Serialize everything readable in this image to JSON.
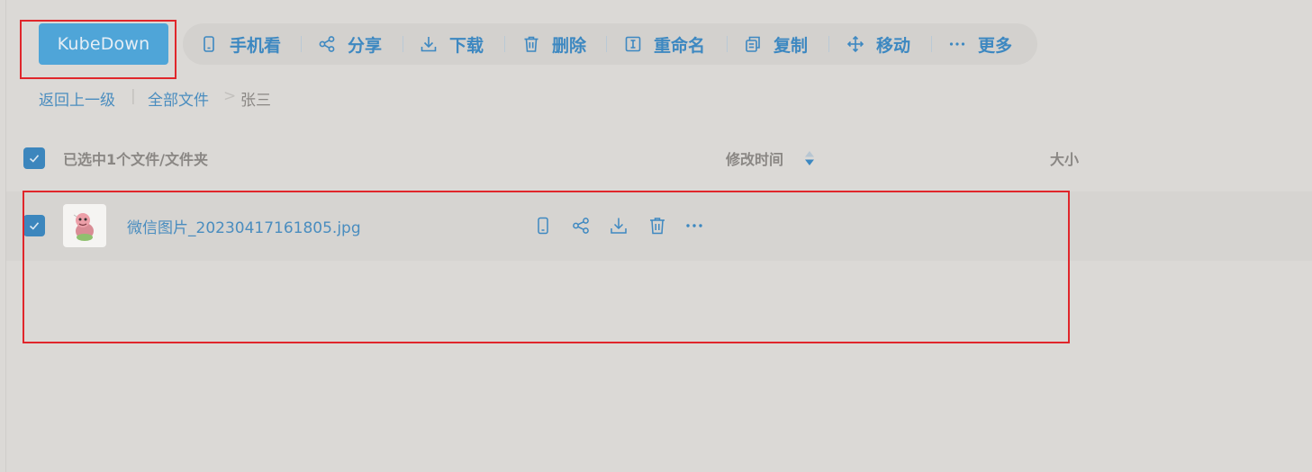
{
  "toolbar": {
    "primary_label": "KubeDown",
    "items": [
      {
        "label": "手机看",
        "icon": "phone-icon"
      },
      {
        "label": "分享",
        "icon": "share-icon"
      },
      {
        "label": "下载",
        "icon": "download-icon"
      },
      {
        "label": "删除",
        "icon": "trash-icon"
      },
      {
        "label": "重命名",
        "icon": "rename-icon"
      },
      {
        "label": "复制",
        "icon": "copy-icon"
      },
      {
        "label": "移动",
        "icon": "move-icon"
      },
      {
        "label": "更多",
        "icon": "more-icon"
      }
    ]
  },
  "breadcrumb": {
    "back": "返回上一级",
    "separator": "|",
    "root": "全部文件",
    "arrow": ">",
    "current": "张三"
  },
  "list_header": {
    "selection_text": "已选中1个文件/文件夹",
    "modified_col": "修改时间",
    "size_col": "大小"
  },
  "files": [
    {
      "name": "微信图片_20230417161805.jpg",
      "selected": true,
      "actions": [
        "phone-icon",
        "share-icon",
        "download-icon",
        "trash-icon",
        "more-icon"
      ]
    }
  ],
  "colors": {
    "accent": "#3d88c1",
    "primary_button": "#4fa5d8",
    "highlight_box": "#e0262b",
    "background": "#dbd9d6"
  }
}
